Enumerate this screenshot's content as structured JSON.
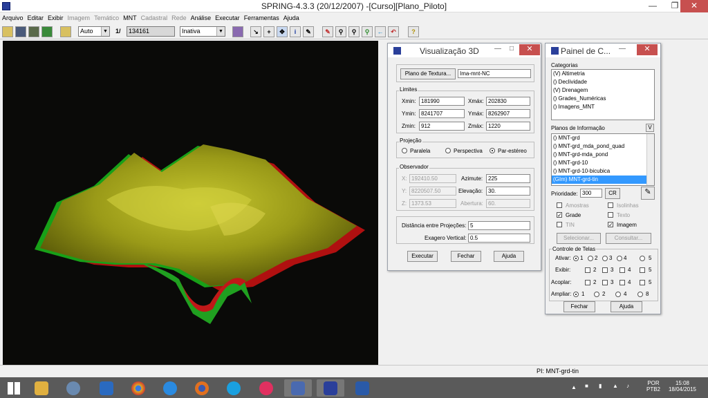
{
  "window": {
    "title": "SPRING-4.3.3 (20/12/2007) -[Curso][Plano_Piloto]"
  },
  "menu": [
    {
      "label": "Arquivo",
      "enabled": true
    },
    {
      "label": "Editar",
      "enabled": true
    },
    {
      "label": "Exibir",
      "enabled": true
    },
    {
      "label": "Imagem",
      "enabled": false
    },
    {
      "label": "Temático",
      "enabled": false
    },
    {
      "label": "MNT",
      "enabled": true
    },
    {
      "label": "Cadastral",
      "enabled": false
    },
    {
      "label": "Rede",
      "enabled": false
    },
    {
      "label": "Análise",
      "enabled": true
    },
    {
      "label": "Executar",
      "enabled": true
    },
    {
      "label": "Ferramentas",
      "enabled": true
    },
    {
      "label": "Ajuda",
      "enabled": true
    }
  ],
  "toolbar": {
    "zoom_mode": "Auto",
    "scale_prefix": "1/",
    "scale_value": "134161",
    "display_mode": "Inativa"
  },
  "status": {
    "pi": "PI: MNT-grd-tin"
  },
  "viz3d": {
    "title": "Visualização 3D",
    "textura_button": "Plano de Textura...",
    "textura_value": "Ima-mnt-NC",
    "limites_label": "Limites",
    "xmin_label": "Xmin:",
    "xmin": "181990",
    "xmax_label": "Xmáx:",
    "xmax": "202830",
    "ymin_label": "Ymin:",
    "ymin": "8241707",
    "ymax_label": "Ymáx:",
    "ymax": "8262907",
    "zmin_label": "Zmin:",
    "zmin": "912",
    "zmax_label": "Zmáx:",
    "zmax": "1220",
    "projecao_label": "Projeção",
    "proj_paralela": "Paralela",
    "proj_perspectiva": "Perspectiva",
    "proj_parestereo": "Par-estéreo",
    "observador_label": "Observador",
    "x_label": "X:",
    "x": "192410.50",
    "y_label": "Y:",
    "y": "8220507.50",
    "z_label": "Z:",
    "z": "1373.53",
    "azimute_label": "Azimute:",
    "azimute": "225",
    "elevacao_label": "Elevação:",
    "elevacao": "30.",
    "abertura_label": "Abertura:",
    "abertura": "60.",
    "distancia_label": "Distância entre Projeções:",
    "distancia": "5",
    "exagero_label": "Exagero Vertical:",
    "exagero": "0.5",
    "executar": "Executar",
    "fechar": "Fechar",
    "ajuda": "Ajuda"
  },
  "painel": {
    "title": "Painel de C...",
    "categorias_label": "Categorias",
    "categorias": [
      "(V) Altimetria",
      "() Declividade",
      "(V) Drenagem",
      "() Grades_Numéricas",
      "() Imagens_MNT"
    ],
    "planos_label": "Planos de Informação",
    "planos_v": "V",
    "planos": [
      "() MNT-grd",
      "() MNT-grd_mda_pond_quad",
      "() MNT-grd-mda_pond",
      "() MNT-grd-10",
      "() MNT-grd-10-bicubica",
      "(GIm) MNT-grd-tin"
    ],
    "prioridade_label": "Prioridade:",
    "prioridade": "300",
    "cr": "CR",
    "amostras": "Amostras",
    "isolinhas": "Isolinhas",
    "grade": "Grade",
    "texto": "Texto",
    "tin": "TIN",
    "imagem": "Imagem",
    "selecionar": "Selecionar...",
    "consultar": "Consultar...",
    "controle_label": "Controle de Telas",
    "ativar_label": "Ativar:",
    "exibir_label": "Exibir:",
    "acoplar_label": "Acoplar:",
    "ampliar_label": "Ampliar:",
    "n1": "1",
    "n2": "2",
    "n3": "3",
    "n4": "4",
    "n5": "5",
    "n8": "8",
    "fechar": "Fechar",
    "ajuda": "Ajuda"
  },
  "tray": {
    "lang": "POR",
    "layout": "PTB2",
    "time": "15:08",
    "date": "18/04/2015"
  }
}
